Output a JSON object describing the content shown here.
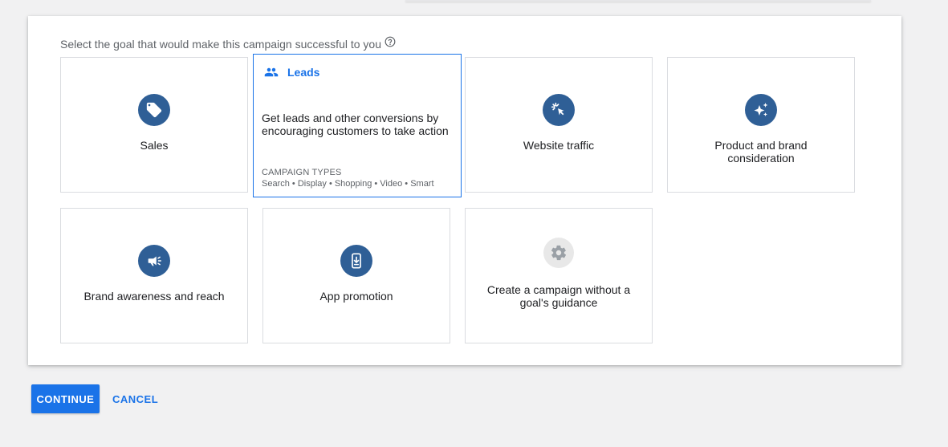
{
  "prompt": {
    "text": "Select the goal that would make this campaign successful to you",
    "help_icon": "help-circle-icon"
  },
  "goals": [
    {
      "id": "sales",
      "label": "Sales",
      "icon": "tag-icon"
    },
    {
      "id": "leads",
      "label": "Leads",
      "icon": "people-icon",
      "description": "Get leads and other conversions by encouraging customers to take action",
      "types_title": "CAMPAIGN TYPES",
      "types": "Search • Display • Shopping • Video • Smart",
      "selected": true
    },
    {
      "id": "website-traffic",
      "label": "Website traffic",
      "icon": "cursor-click-icon"
    },
    {
      "id": "product-brand",
      "label": "Product and brand consideration",
      "icon": "sparkle-icon"
    },
    {
      "id": "brand-awareness",
      "label": "Brand awareness and reach",
      "icon": "megaphone-icon"
    },
    {
      "id": "app-promotion",
      "label": "App promotion",
      "icon": "phone-download-icon"
    },
    {
      "id": "no-goal",
      "label": "Create a campaign without a goal's guidance",
      "icon": "gear-icon"
    }
  ],
  "actions": {
    "continue_label": "CONTINUE",
    "cancel_label": "CANCEL"
  },
  "colors": {
    "accent": "#1a73e8",
    "icon_circle": "#2f5f96",
    "border": "#dadce0",
    "page_bg": "#f1f1f2"
  }
}
